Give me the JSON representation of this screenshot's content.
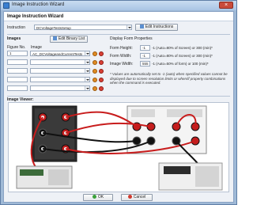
{
  "window": {
    "title": "Image Instruction Wizard"
  },
  "header": {
    "title": "Image Instruction Wizard"
  },
  "instruction": {
    "label": "Instruction",
    "value": "DCVoltageTestsSetup",
    "edit_button": "Edit Instructions"
  },
  "images": {
    "section_title": "Images",
    "edit_binary_list_button": "Edit Binary List",
    "col_figure": "Figure No.",
    "col_image": "Image",
    "rows": [
      {
        "figure": "1",
        "image": "AC_DCVoltageandCurrentTests"
      },
      {
        "figure": "",
        "image": ""
      },
      {
        "figure": "",
        "image": ""
      },
      {
        "figure": "",
        "image": ""
      },
      {
        "figure": "",
        "image": ""
      }
    ]
  },
  "display_form": {
    "title": "Display Form Properties",
    "height_label": "Form Height:",
    "height_value": "-1",
    "height_hint": "-1 (Auto=80% of Screen) or 300 (min)*",
    "width_label": "Form Width:",
    "width_value": "-1",
    "width_hint": "-1 (Auto=80% of Screen) or 300 (min)*",
    "img_width_label": "Image Width:",
    "img_width_value": "555",
    "img_width_hint": "-1 (Auto=50% of form) or 100 (min)*",
    "note": "* Values are automatically set to -1 (auto) when specified values cannot be displayed due to screen resolution limits or when/if property combinations when the command is executed."
  },
  "viewer": {
    "title": "Image Viewer:"
  },
  "footer": {
    "ok": "OK",
    "cancel": "Cancel"
  },
  "icons": {
    "app": "wizard-icon",
    "brush": "brush-icon",
    "delete": "delete-icon"
  },
  "colors": {
    "accent": "#3a7fd1",
    "titlebar": "#a9c4e4",
    "close": "#c94b3b"
  }
}
